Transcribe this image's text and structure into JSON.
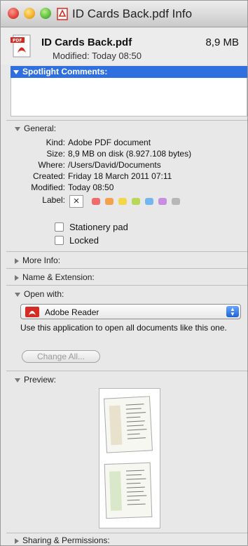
{
  "window": {
    "title": "ID Cards Back.pdf Info"
  },
  "file": {
    "name": "ID Cards Back.pdf",
    "size": "8,9 MB",
    "modified": "Modified: Today 08:50",
    "icon": "pdf-file-icon"
  },
  "spotlight": {
    "header": "Spotlight Comments:",
    "value": ""
  },
  "general": {
    "header": "General:",
    "rows": [
      {
        "key": "Kind:",
        "value": "Adobe PDF document"
      },
      {
        "key": "Size:",
        "value": "8,9 MB on disk (8.927.108 bytes)"
      },
      {
        "key": "Where:",
        "value": "/Users/David/Documents"
      },
      {
        "key": "Created:",
        "value": "Friday 18 March 2011 07:11"
      },
      {
        "key": "Modified:",
        "value": "Today 08:50"
      }
    ],
    "label_key": "Label:",
    "label_none": "×",
    "label_colors": [
      "#f06b6b",
      "#f4a14d",
      "#f2d64b",
      "#b7d957",
      "#74b7f0",
      "#c88de0",
      "#b7b7b7"
    ],
    "stationery": "Stationery pad",
    "locked": "Locked",
    "stationery_checked": false,
    "locked_checked": false
  },
  "sections": {
    "more_info": "More Info:",
    "name_ext": "Name & Extension:",
    "open_with": "Open with:",
    "preview": "Preview:",
    "sharing": "Sharing & Permissions:"
  },
  "open_with": {
    "app": "Adobe Reader",
    "app_icon": "adobe-reader-icon",
    "description": "Use this application to open all documents like this one.",
    "change_all": "Change All..."
  },
  "colors": {
    "accent": "#2f6fe0",
    "pdf_red": "#d62b22"
  }
}
